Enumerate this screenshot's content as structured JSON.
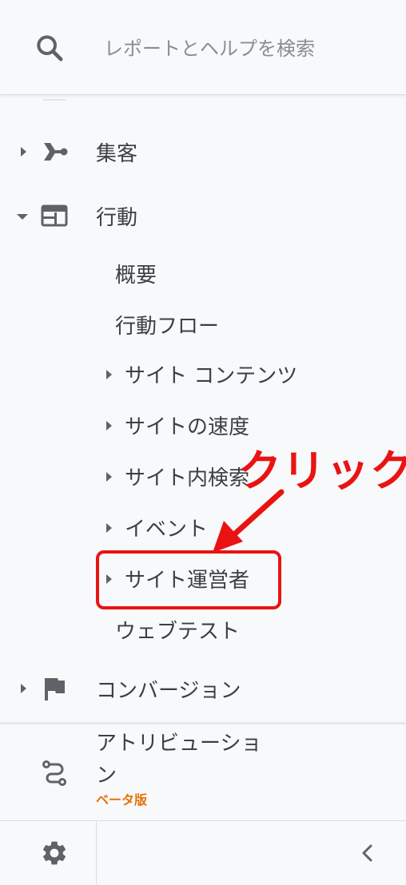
{
  "search": {
    "placeholder": "レポートとヘルプを検索"
  },
  "nav": {
    "acquisition": "集客",
    "behavior": "行動",
    "behavior_children": {
      "overview": "概要",
      "flow": "行動フロー",
      "site_content": "サイト コンテンツ",
      "site_speed": "サイトの速度",
      "site_search": "サイト内検索",
      "events": "イベント",
      "publisher": "サイト運営者",
      "experiments": "ウェブテスト"
    },
    "conversions": "コンバージョン",
    "attribution_line1": "アトリビューショ",
    "attribution_line2": "ン",
    "attribution_badge": "ベータ版"
  },
  "annotation": {
    "callout": "クリック",
    "color": "#ea1313"
  },
  "colors": {
    "icon": "#5f6368",
    "text": "#3c4043",
    "beta": "#e8710a"
  }
}
